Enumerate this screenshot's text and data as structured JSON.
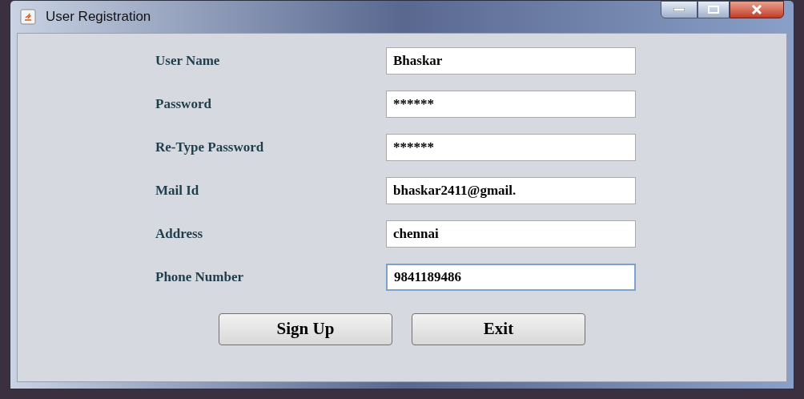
{
  "window": {
    "title": "User Registration"
  },
  "form": {
    "fields": [
      {
        "label": "User Name",
        "value": "Bhaskar",
        "focused": false
      },
      {
        "label": "Password",
        "value": "******",
        "focused": false
      },
      {
        "label": "Re-Type Password",
        "value": "******",
        "focused": false
      },
      {
        "label": "Mail Id",
        "value": "bhaskar2411@gmail.",
        "focused": false
      },
      {
        "label": "Address",
        "value": "chennai",
        "focused": false
      },
      {
        "label": "Phone Number",
        "value": "9841189486",
        "focused": true
      }
    ]
  },
  "buttons": [
    "Sign Up",
    "Exit"
  ]
}
